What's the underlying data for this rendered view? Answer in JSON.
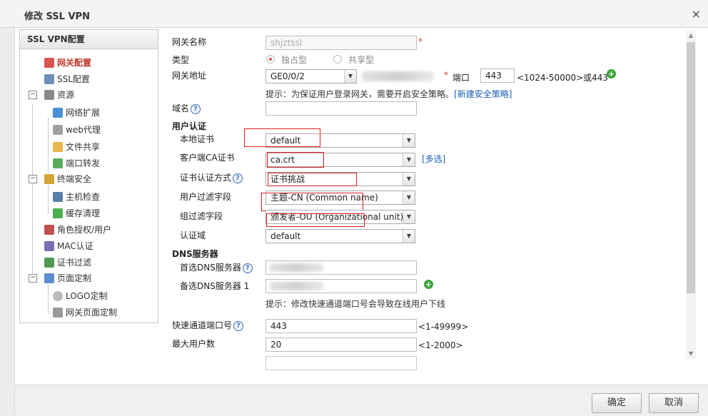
{
  "window": {
    "title": "修改 SSL VPN",
    "close": "×"
  },
  "nav": {
    "title": "SSL VPN配置",
    "items": [
      {
        "label": "网关配置"
      },
      {
        "label": "SSL配置"
      },
      {
        "label": "资源",
        "toggle": "−"
      },
      {
        "label": "网络扩展"
      },
      {
        "label": "web代理"
      },
      {
        "label": "文件共享"
      },
      {
        "label": "端口转发"
      },
      {
        "label": "终端安全",
        "toggle": "−"
      },
      {
        "label": "主机检查"
      },
      {
        "label": "缓存清理"
      },
      {
        "label": "角色授权/用户"
      },
      {
        "label": "MAC认证"
      },
      {
        "label": "证书过滤"
      },
      {
        "label": "页面定制",
        "toggle": "−"
      },
      {
        "label": "LOGO定制"
      },
      {
        "label": "网关页面定制"
      }
    ]
  },
  "form": {
    "gateway_name_label": "网关名称",
    "gateway_name_value": "shjztssl",
    "type_label": "类型",
    "type_exclusive": "独占型",
    "type_shared": "共享型",
    "gateway_addr_label": "网关地址",
    "gateway_addr_value": "GE0/0/2",
    "port_label": "端口",
    "port_value": "443",
    "port_range": "<1024-50000>或443",
    "hint1_text": "提示：为保证用户登录网关，需要开启安全策略。",
    "hint1_link": "[新建安全策略]",
    "domain_label": "域名",
    "domain_value": "",
    "user_auth_section": "用户认证",
    "local_cert_label": "本地证书",
    "local_cert_value": "default",
    "client_ca_label": "客户端CA证书",
    "client_ca_value": "ca.crt",
    "multi_select": "[多选]",
    "cert_auth_label": "证书认证方式",
    "cert_auth_value": "证书挑战",
    "user_filter_label": "用户过滤字段",
    "user_filter_value": "主题-CN (Common name)",
    "group_filter_label": "组过滤字段",
    "group_filter_value": "颁发者-OU (Organizational unit)",
    "auth_domain_label": "认证域",
    "auth_domain_value": "default",
    "dns_section": "DNS服务器",
    "dns1_label": "首选DNS服务器",
    "dns2_label": "备选DNS服务器 1",
    "hint2_text": "提示：修改快速通道端口号会导致在线用户下线",
    "fast_port_label": "快速通道端口号",
    "fast_port_value": "443",
    "fast_port_range": "<1-49999>",
    "max_users_label": "最大用户数",
    "max_users_value": "20",
    "max_users_range": "<1-2000>",
    "help_glyph": "?",
    "required_mark": "*",
    "arrow_glyph": "▼",
    "plus_glyph": "+"
  },
  "buttons": {
    "ok": "确定",
    "cancel": "取消"
  },
  "colors": {
    "annotation_red": "#e02020",
    "link_blue": "#1a5fb4",
    "active_nav": "#c0392b"
  }
}
